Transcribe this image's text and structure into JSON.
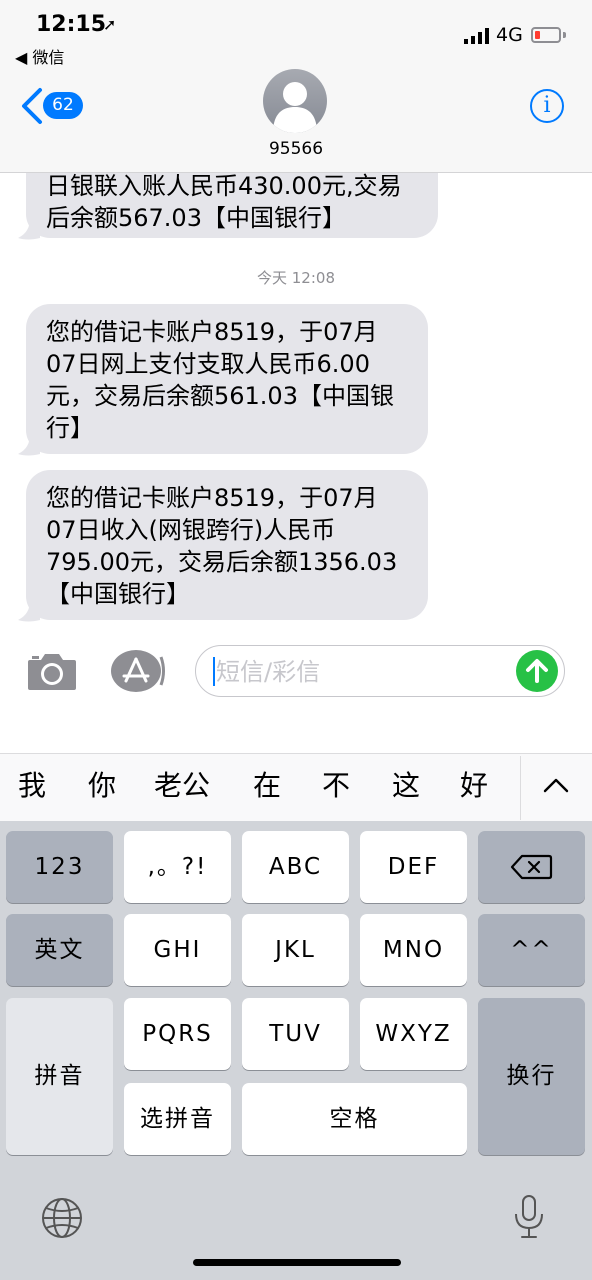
{
  "status_bar": {
    "time": "12:15",
    "location_arrow": "➚",
    "back_app": "◀ 微信",
    "network": "4G"
  },
  "header": {
    "back_count": "62",
    "contact_name": "95566",
    "info_label": "i"
  },
  "messages": [
    {
      "text": "日银联入账人民币430.00元,交易后余额567.03【中国银行】"
    },
    {
      "text": "您的借记卡账户8519，于07月07日网上支付支取人民币6.00元，交易后余额561.03【中国银行】"
    },
    {
      "text": "您的借记卡账户8519，于07月07日收入(网银跨行)人民币795.00元，交易后余额1356.03【中国银行】"
    }
  ],
  "timestamp": "今天 12:08",
  "composer": {
    "placeholder": "短信/彩信"
  },
  "candidates": [
    "我",
    "你",
    "老公",
    "在",
    "不",
    "这",
    "好"
  ],
  "keys": {
    "numbers": "123",
    "punct": ",。?!",
    "abc": "ABC",
    "def": "DEF",
    "english": "英文",
    "ghi": "GHI",
    "jkl": "JKL",
    "mno": "MNO",
    "emoji": "^^",
    "pinyin": "拼音",
    "pqrs": "PQRS",
    "tuv": "TUV",
    "wxyz": "WXYZ",
    "return": "换行",
    "select_pinyin": "选拼音",
    "space": "空格"
  },
  "icons": {
    "delete": "delete-icon",
    "globe": "globe-icon",
    "microphone": "microphone-icon",
    "send": "send-icon"
  },
  "colors": {
    "accent": "#007aff",
    "send": "#27c146",
    "bubble": "#e5e5ea",
    "battery_low": "#ff3b30"
  }
}
